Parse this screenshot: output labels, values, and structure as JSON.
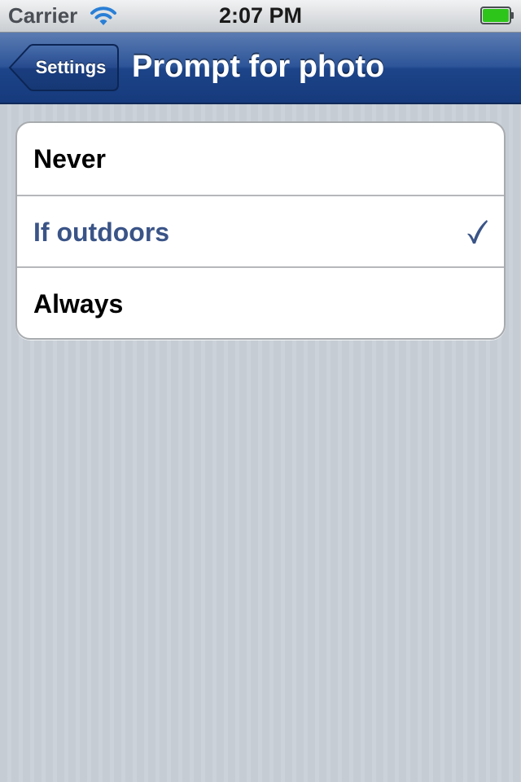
{
  "status_bar": {
    "carrier": "Carrier",
    "time": "2:07 PM",
    "wifi_icon": "wifi-icon",
    "battery_icon": "battery-full-icon",
    "battery_level": 1.0,
    "battery_color": "#2ec51b"
  },
  "nav_bar": {
    "back_label": "Settings",
    "title": "Prompt for photo"
  },
  "options": {
    "items": [
      {
        "label": "Never",
        "selected": false
      },
      {
        "label": "If outdoors",
        "selected": true
      },
      {
        "label": "Always",
        "selected": false
      }
    ],
    "selected_color": "#3a5487",
    "checkmark_icon": "checkmark-icon"
  }
}
